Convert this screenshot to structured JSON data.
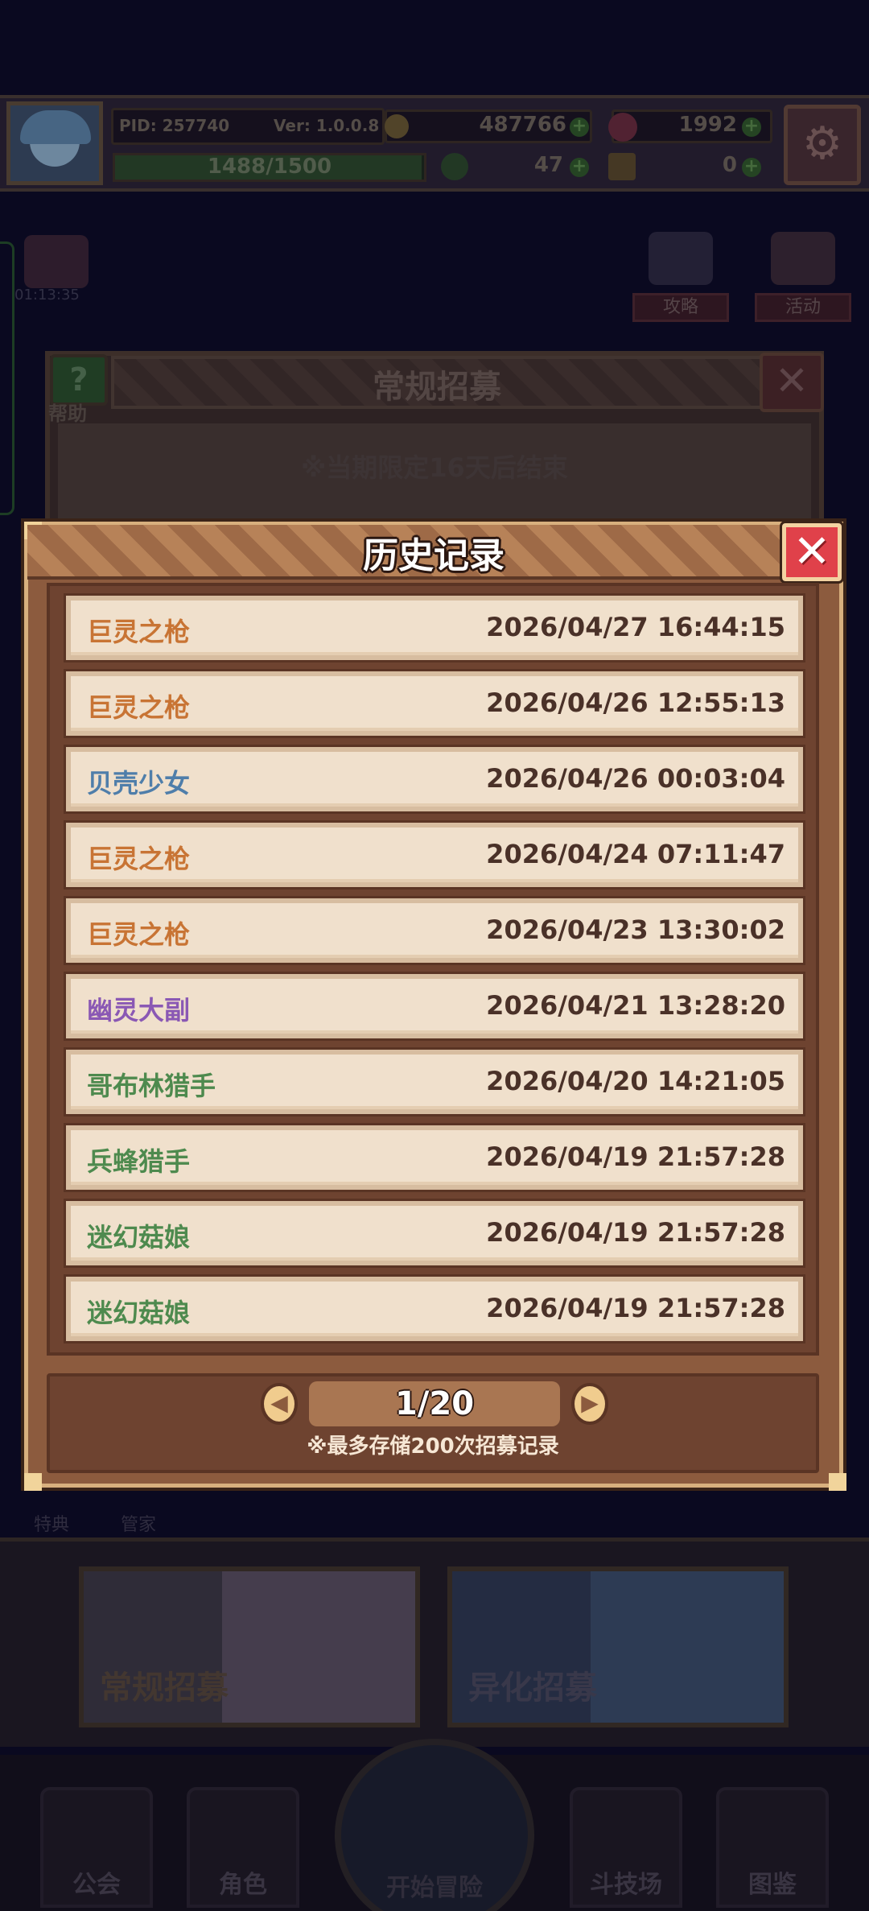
{
  "top_bar": {
    "pid": "PID: 257740",
    "version": "Ver: 1.0.0.8",
    "gold": "487766",
    "gems": "1992",
    "xp_text": "1488/1500",
    "xp_progress": 0.992,
    "clover": "47",
    "keys": "0"
  },
  "side_buttons": {
    "timer": "01:13:35",
    "guide": "攻略",
    "events": "活动"
  },
  "recruit_panel": {
    "title": "常规招募",
    "help": "帮助",
    "limit_notice": "※当期限定16天后结束"
  },
  "history_modal": {
    "title": "历史记录",
    "rows": [
      {
        "name": "巨灵之枪",
        "time": "2026/04/27 16:44:15",
        "color": "#c87434"
      },
      {
        "name": "巨灵之枪",
        "time": "2026/04/26 12:55:13",
        "color": "#c87434"
      },
      {
        "name": "贝壳少女",
        "time": "2026/04/26 00:03:04",
        "color": "#4f7eaa"
      },
      {
        "name": "巨灵之枪",
        "time": "2026/04/24 07:11:47",
        "color": "#c87434"
      },
      {
        "name": "巨灵之枪",
        "time": "2026/04/23 13:30:02",
        "color": "#c87434"
      },
      {
        "name": "幽灵大副",
        "time": "2026/04/21 13:28:20",
        "color": "#8a58b4"
      },
      {
        "name": "哥布林猎手",
        "time": "2026/04/20 14:21:05",
        "color": "#4e8a4e"
      },
      {
        "name": "兵蜂猎手",
        "time": "2026/04/19 21:57:28",
        "color": "#4e8a4e"
      },
      {
        "name": "迷幻菇娘",
        "time": "2026/04/19 21:57:28",
        "color": "#4e8a4e"
      },
      {
        "name": "迷幻菇娘",
        "time": "2026/04/19 21:57:28",
        "color": "#4e8a4e"
      }
    ],
    "page": "1/20",
    "note": "※最多存储200次招募记录"
  },
  "lower_tabs": {
    "tab1": "特典",
    "tab2": "管家"
  },
  "recruit_cards": {
    "normal": "常规招募",
    "special": "异化招募"
  },
  "nav": {
    "guild": "公会",
    "character": "角色",
    "adventure": "开始冒险",
    "arena": "斗技场",
    "codex": "图鉴"
  }
}
